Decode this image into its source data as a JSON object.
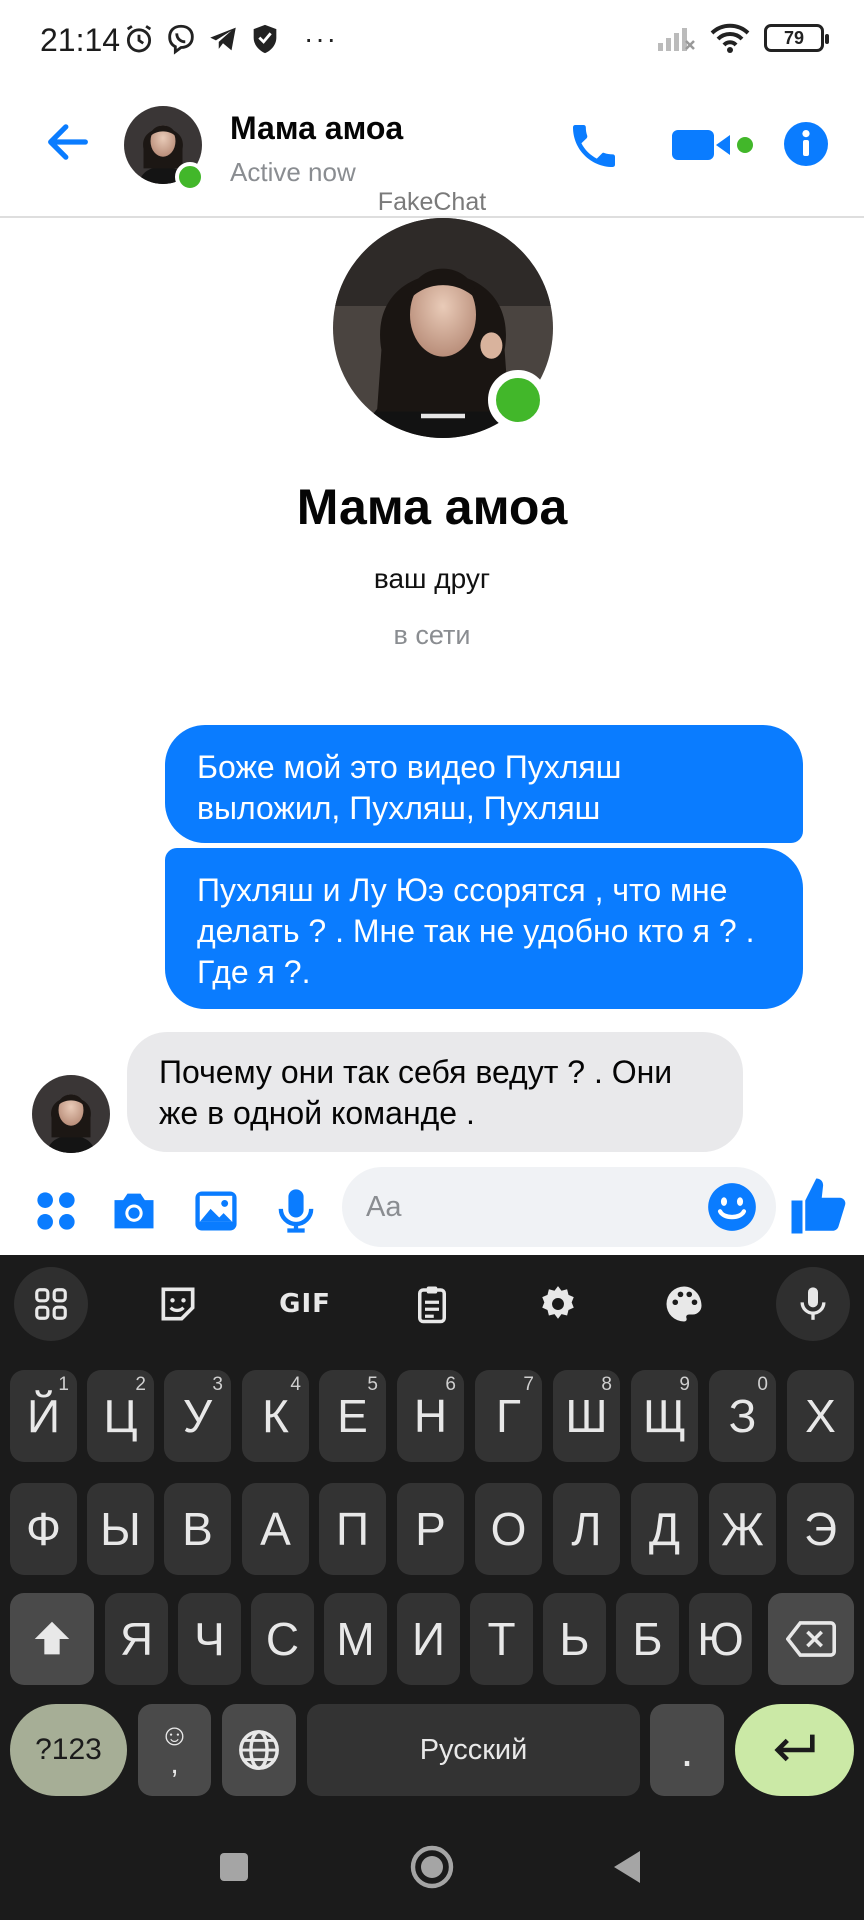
{
  "status_bar": {
    "time": "21:14",
    "battery": "79",
    "more": "···"
  },
  "header": {
    "name": "Мама амоа",
    "status": "Active now"
  },
  "watermark": "FakeChat",
  "profile": {
    "name": "Мама амоа",
    "relation": "ваш друг",
    "online": "в сети"
  },
  "messages": [
    {
      "direction": "outgoing",
      "text": "Боже мой это видео Пухляш выложил, Пухляш, Пухляш"
    },
    {
      "direction": "outgoing",
      "text": "Пухляш и Лу Юэ ссорятся , что мне делать ? . Мне так не удобно кто я ? . Где я ?."
    },
    {
      "direction": "incoming",
      "text": "Почему они так себя ведут ? . Они же в одной команде ."
    }
  ],
  "composer": {
    "placeholder": "Aa"
  },
  "keyboard": {
    "toolbar": {
      "gif": "GIF"
    },
    "row1": [
      "Й",
      "Ц",
      "У",
      "К",
      "Е",
      "Н",
      "Г",
      "Ш",
      "Щ",
      "З",
      "Х"
    ],
    "row1_hints": [
      "1",
      "2",
      "3",
      "4",
      "5",
      "6",
      "7",
      "8",
      "9",
      "0",
      ""
    ],
    "row2": [
      "Ф",
      "Ы",
      "В",
      "А",
      "П",
      "Р",
      "О",
      "Л",
      "Д",
      "Ж",
      "Э"
    ],
    "row3": [
      "Я",
      "Ч",
      "С",
      "М",
      "И",
      "Т",
      "Ь",
      "Б",
      "Ю"
    ],
    "sym_key": "?123",
    "emoji_key_top": "☺",
    "emoji_key_bottom": ",",
    "space": "Русский",
    "period": "."
  },
  "colors": {
    "accent": "#0a7cff",
    "presence": "#42b72a",
    "incoming_bubble": "#e9e9eb",
    "keyboard_bg": "#1b1b1b",
    "key_bg": "#333333",
    "enter_key": "#cbe9a6",
    "sym_key": "#a6ae96"
  }
}
